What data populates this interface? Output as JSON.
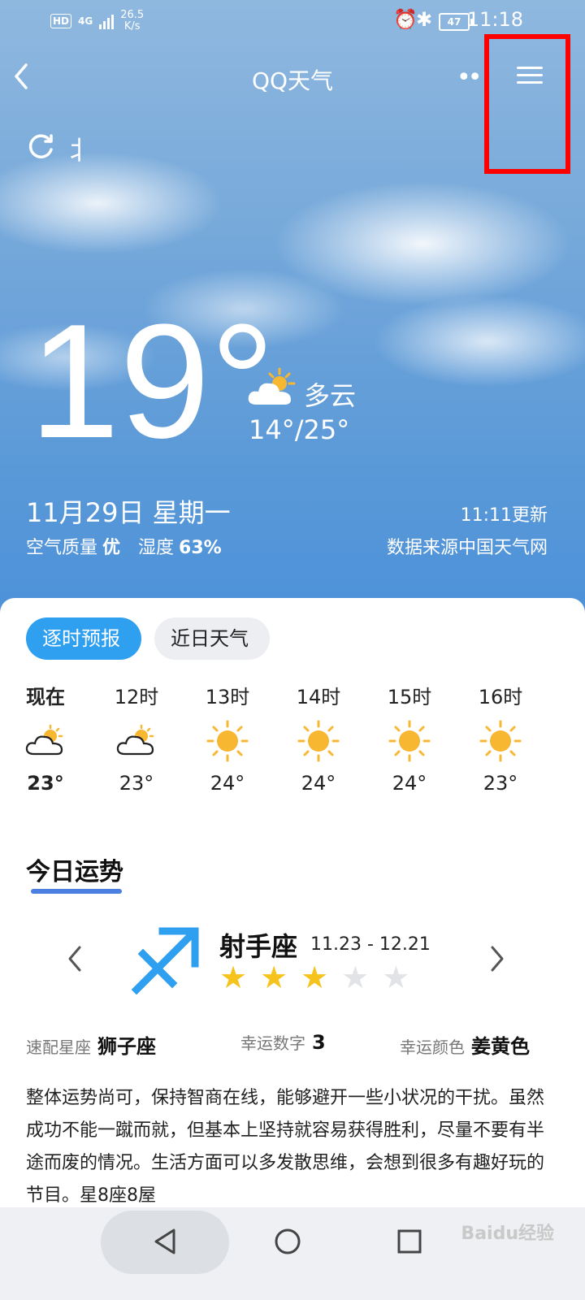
{
  "status_bar": {
    "hd": "HD",
    "net": "4G",
    "speed_value": "26.5",
    "speed_unit": "K/s",
    "battery": "47",
    "time": "11:18"
  },
  "topbar": {
    "back": "<",
    "title": "QQ天气",
    "more": "••"
  },
  "refresh_text": "北",
  "current": {
    "temp": "19°",
    "condition": "多云",
    "range": "14°/25°",
    "date": "11月29日 星期一",
    "updated": "11:11更新",
    "air_label": "空气质量",
    "air_value": "优",
    "humidity_label": "湿度",
    "humidity_value": "63%",
    "source": "数据来源中国天气网"
  },
  "tabs": {
    "hourly": "逐时预报",
    "recent": "近日天气"
  },
  "hourly": [
    {
      "label": "现在",
      "temp": "23°",
      "icon": "partly-cloudy-icon"
    },
    {
      "label": "12时",
      "temp": "23°",
      "icon": "partly-cloudy-icon"
    },
    {
      "label": "13时",
      "temp": "24°",
      "icon": "sunny-icon"
    },
    {
      "label": "14时",
      "temp": "24°",
      "icon": "sunny-icon"
    },
    {
      "label": "15时",
      "temp": "24°",
      "icon": "sunny-icon"
    },
    {
      "label": "16时",
      "temp": "23°",
      "icon": "sunny-icon"
    }
  ],
  "fortune": {
    "title": "今日运势",
    "sign_name": "射手座",
    "sign_date": "11.23 - 12.21",
    "stars": 3,
    "stars_total": 5,
    "match_label": "速配星座",
    "match_value": "狮子座",
    "number_label": "幸运数字",
    "number_value": "3",
    "color_label": "幸运颜色",
    "color_value": "姜黄色",
    "description": "整体运势尚可，保持智商在线，能够避开一些小状况的干扰。虽然成功不能一蹴而就，但基本上坚持就容易获得胜利，尽量不要有半途而废的情况。生活方面可以多发散思维，会想到很多有趣好玩的节目。星8座8屋"
  },
  "colors": {
    "accent": "#2f9ff0",
    "star_on": "#f5c31c",
    "sun": "#f7b731",
    "highlight": "#ff0000"
  },
  "watermark": "Baidu经验"
}
